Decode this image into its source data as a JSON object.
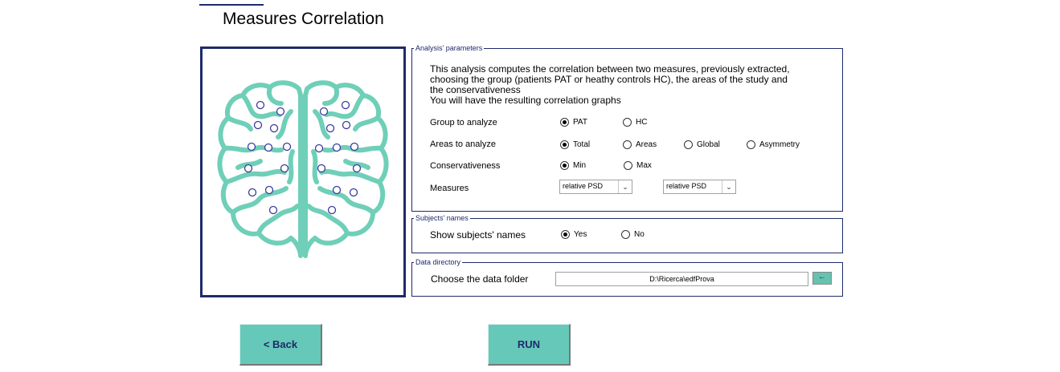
{
  "page": {
    "title": "Measures Correlation"
  },
  "analysis": {
    "legend": "Analysis' parameters",
    "description": "This analysis computes the correlation between two measures, previously extracted,\nchoosing the group (patients PAT or heathy controls HC), the areas of the study and\nthe conservativeness\nYou will have the resulting correlation graphs",
    "group": {
      "label": "Group to analyze",
      "options": [
        "PAT",
        "HC"
      ],
      "selected": "PAT"
    },
    "areas": {
      "label": "Areas to analyze",
      "options": [
        "Total",
        "Areas",
        "Global",
        "Asymmetry"
      ],
      "selected": "Total"
    },
    "conservativeness": {
      "label": "Conservativeness",
      "options": [
        "Min",
        "Max"
      ],
      "selected": "Min"
    },
    "measures": {
      "label": "Measures",
      "measure1": "relative PSD",
      "measure2": "relative PSD"
    }
  },
  "subjects": {
    "legend": "Subjects' names",
    "label": "Show subjects' names",
    "options": [
      "Yes",
      "No"
    ],
    "selected": "Yes"
  },
  "data_directory": {
    "legend": "Data directory",
    "label": "Choose the data folder",
    "path": "D:\\Ricerca\\edfProva",
    "browse_label": "←"
  },
  "buttons": {
    "back": "< Back",
    "run": "RUN"
  },
  "colors": {
    "accent": "#66c8b8",
    "frame": "#1f2a6b",
    "brain": "#6fcfb8",
    "electrode": "#3a3aa0"
  },
  "icons": {
    "arrow_down": "chevron-down-icon",
    "brain": "brain-illustration"
  }
}
